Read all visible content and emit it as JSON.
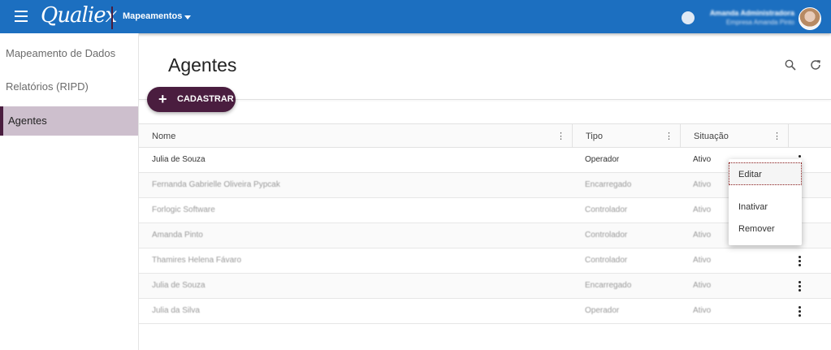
{
  "header": {
    "logo": "Qualiex",
    "module": "Mapeamentos",
    "user_name": "Amanda Administradora",
    "user_company": "Empresa Amanda Pinto"
  },
  "sidebar": {
    "items": [
      {
        "label": "Mapeamento de Dados"
      },
      {
        "label": "Relatórios (RIPD)"
      },
      {
        "label": "Agentes"
      }
    ]
  },
  "main": {
    "title": "Agentes",
    "add_button": "CADASTRAR"
  },
  "table": {
    "columns": [
      "Nome",
      "Tipo",
      "Situação"
    ],
    "rows": [
      {
        "name": "Julia de Souza",
        "type": "Operador",
        "status": "Ativo"
      },
      {
        "name": "Fernanda Gabrielle Oliveira Pypcak",
        "type": "Encarregado",
        "status": "Ativo"
      },
      {
        "name": "Forlogic Software",
        "type": "Controlador",
        "status": "Ativo"
      },
      {
        "name": "Amanda Pinto",
        "type": "Controlador",
        "status": "Ativo"
      },
      {
        "name": "Thamires Helena Fávaro",
        "type": "Controlador",
        "status": "Ativo"
      },
      {
        "name": "Julia de Souza",
        "type": "Encarregado",
        "status": "Ativo"
      },
      {
        "name": "Julia da Silva",
        "type": "Operador",
        "status": "Ativo"
      }
    ]
  },
  "context_menu": {
    "items": [
      "Editar",
      "Inativar",
      "Remover"
    ]
  },
  "colors": {
    "topbar": "#1c6fc0",
    "brand": "#4a1d3f",
    "active_sidebar": "#cdbfcd"
  }
}
